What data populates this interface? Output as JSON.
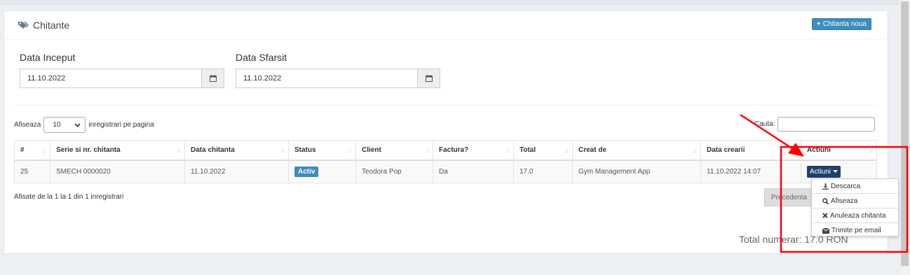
{
  "header": {
    "title": "Chitante",
    "new_button": "Chitanta noua"
  },
  "filters": {
    "start_label": "Data Inceput",
    "start_value": "11.10.2022",
    "end_label": "Data Sfarsit",
    "end_value": "11.10.2022"
  },
  "table_controls": {
    "show_label": "Afiseaza",
    "page_size": "10",
    "per_page_label": "inregistrari pe pagina",
    "search_label": "Cauta:"
  },
  "table": {
    "columns": [
      "#",
      "Serie si nr. chitanta",
      "Data chitanta",
      "Status",
      "Client",
      "Factura?",
      "Total",
      "Creat de",
      "Data crearii",
      "Actiuni"
    ],
    "row": {
      "id": "25",
      "serie": "SMECH 0000020",
      "data": "11.10.2022",
      "status": "Activ",
      "client": "Teodora Pop",
      "factura": "Da",
      "total": "17.0",
      "creat_de": "Gym Management App",
      "data_crearii": "11.10.2022 14:07",
      "actions": "Actiuni"
    }
  },
  "footer": {
    "info": "Afisate de la 1 la 1 din 1 inregistrari",
    "prev": "Precedenta",
    "total": "Total numerar: 17.0 RON"
  },
  "dropdown": {
    "items": [
      "Descarca",
      "Afiseaza",
      "Anuleaza chitanta",
      "Trimite pe email"
    ]
  },
  "colors": {
    "primary": "#3c8dbc",
    "dark_button": "#1f3f69",
    "annotation": "#ff0000"
  }
}
